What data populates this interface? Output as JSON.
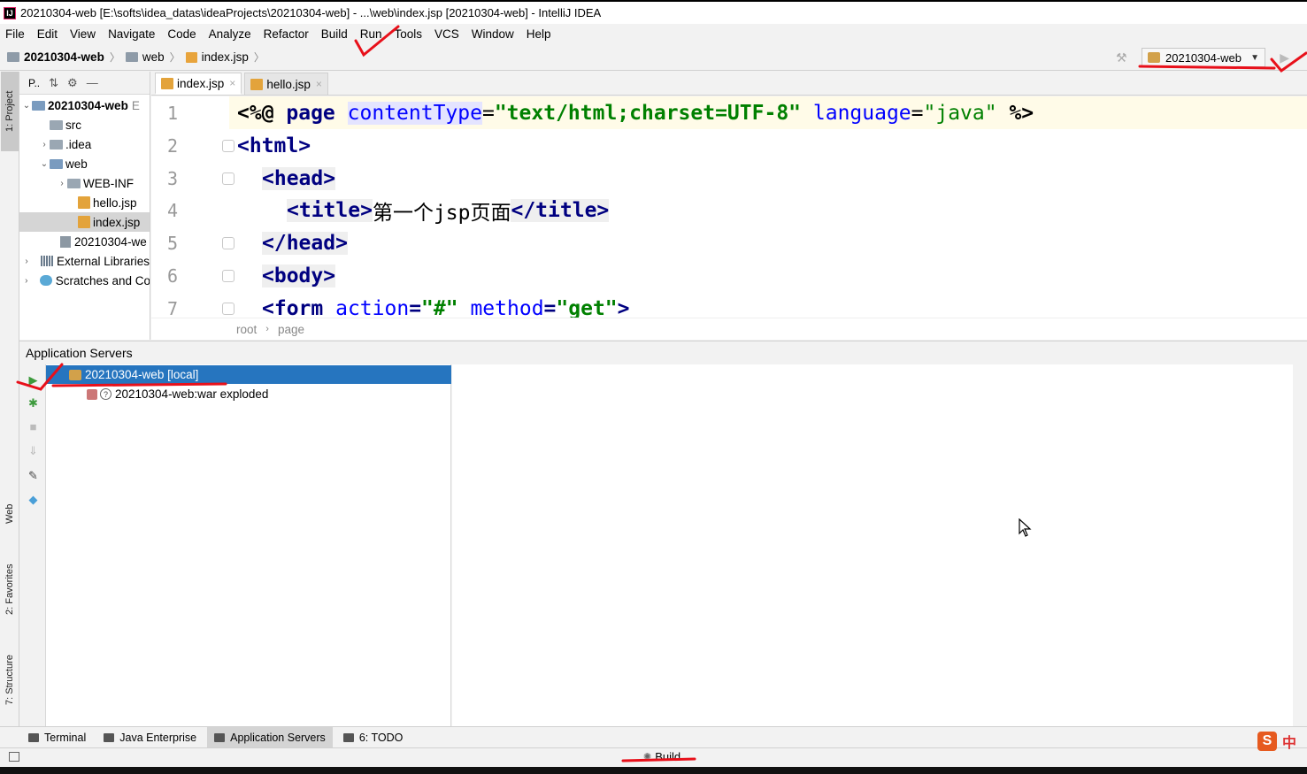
{
  "window": {
    "title": "20210304-web [E:\\softs\\idea_datas\\ideaProjects\\20210304-web] - ...\\web\\index.jsp [20210304-web] - IntelliJ IDEA",
    "app_icon": "IJ"
  },
  "menu": [
    "File",
    "Edit",
    "View",
    "Navigate",
    "Code",
    "Analyze",
    "Refactor",
    "Build",
    "Run",
    "Tools",
    "VCS",
    "Window",
    "Help"
  ],
  "navbar": {
    "crumbs": [
      "20210304-web",
      "web",
      "index.jsp"
    ],
    "run_config": "20210304-web"
  },
  "left_strip": {
    "project_tab": "1: Project",
    "web_tab": "Web",
    "favorites_tab": "2: Favorites",
    "structure_tab": "7: Structure"
  },
  "project_panel": {
    "header": "P..",
    "tree": [
      {
        "label": "20210304-web",
        "suffix": "E",
        "arrow": "⌄",
        "icon": "module"
      },
      {
        "label": "src",
        "arrow": "",
        "icon": "folder"
      },
      {
        "label": ".idea",
        "arrow": "›",
        "icon": "folder"
      },
      {
        "label": "web",
        "arrow": "⌄",
        "icon": "folder-web"
      },
      {
        "label": "WEB-INF",
        "arrow": "›",
        "icon": "folder"
      },
      {
        "label": "hello.jsp",
        "arrow": "",
        "icon": "jsp-file"
      },
      {
        "label": "index.jsp",
        "arrow": "",
        "icon": "jsp-file"
      },
      {
        "label": "20210304-we",
        "arrow": "",
        "icon": "iml-file"
      },
      {
        "label": "External Libraries",
        "arrow": "›",
        "icon": "libraries"
      },
      {
        "label": "Scratches and Co",
        "arrow": "›",
        "icon": "scratches"
      }
    ]
  },
  "editor": {
    "tabs": [
      {
        "label": "index.jsp",
        "close": "×"
      },
      {
        "label": "hello.jsp",
        "close": "×"
      }
    ],
    "line_numbers": [
      "1",
      "2",
      "3",
      "4",
      "5",
      "6",
      "7"
    ],
    "lines": {
      "l1": {
        "open": "<%@ ",
        "kw": "page",
        "sp1": " ",
        "attr1": "contentType",
        "eq1": "=",
        "val1": "\"text/html;charset=UTF-8\"",
        "sp2": " ",
        "attr2": "language",
        "eq2": "=",
        "val2": "\"java\"",
        "close": " %>"
      },
      "l2": "<html>",
      "l3": "<head>",
      "l4": {
        "open": "<title>",
        "text": "第一个jsp页面",
        "close": "</title>"
      },
      "l5": "</head>",
      "l6": "<body>",
      "l7": {
        "open": "<form ",
        "attr1": "action",
        "eq1": "=",
        "val1": "\"#\"",
        "sp": " ",
        "attr2": "method",
        "eq2": "=",
        "val2": "\"get\"",
        "close": ">"
      }
    },
    "breadcrumb": [
      "root",
      "page"
    ]
  },
  "app_servers": {
    "title": "Application Servers",
    "server": "20210304-web [local]",
    "artifact": "20210304-web:war exploded"
  },
  "bottom_tabs": [
    {
      "label": "Terminal"
    },
    {
      "label": "Java Enterprise"
    },
    {
      "label": "Application Servers"
    },
    {
      "label": "6: TODO"
    }
  ],
  "status": {
    "build": "Build"
  },
  "ime": {
    "logo": "S",
    "lang": "中"
  },
  "colors": {
    "selection": "#2675bf",
    "annotation_red": "#e8101a",
    "tag": "#000080",
    "attribute": "#0000ff",
    "string": "#008000"
  }
}
